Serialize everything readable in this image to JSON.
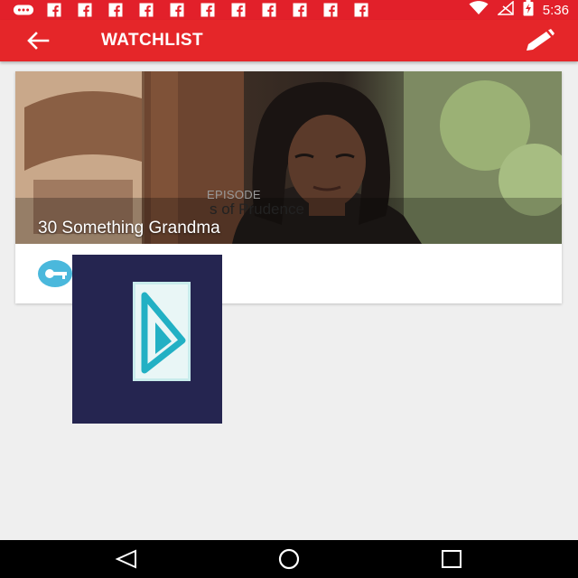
{
  "status_bar": {
    "time": "5:36",
    "notification_icons": [
      "chat-icon",
      "facebook-icon",
      "facebook-icon",
      "facebook-icon",
      "facebook-icon",
      "facebook-icon",
      "facebook-icon",
      "facebook-icon",
      "facebook-icon",
      "facebook-icon",
      "facebook-icon",
      "facebook-icon"
    ],
    "system_icons": [
      "wifi-icon",
      "cellular-no-signal-icon",
      "battery-charging-icon"
    ]
  },
  "app_bar": {
    "title": "WATCHLIST",
    "back_icon": "arrow-back-icon",
    "edit_icon": "pencil-icon"
  },
  "watchlist": {
    "items": [
      {
        "title": "30 Something Grandma",
        "episode_label": "EPISODE",
        "episode_title": "s of Prudence"
      }
    ]
  },
  "colors": {
    "primary": "#e52629",
    "status_bar": "#e2202a",
    "background": "#efefef",
    "overlay_bg": "#252550",
    "accent": "#2fb0d4"
  },
  "nav_bar": {
    "buttons": [
      "back-triangle-icon",
      "home-circle-icon",
      "recents-square-icon"
    ]
  }
}
